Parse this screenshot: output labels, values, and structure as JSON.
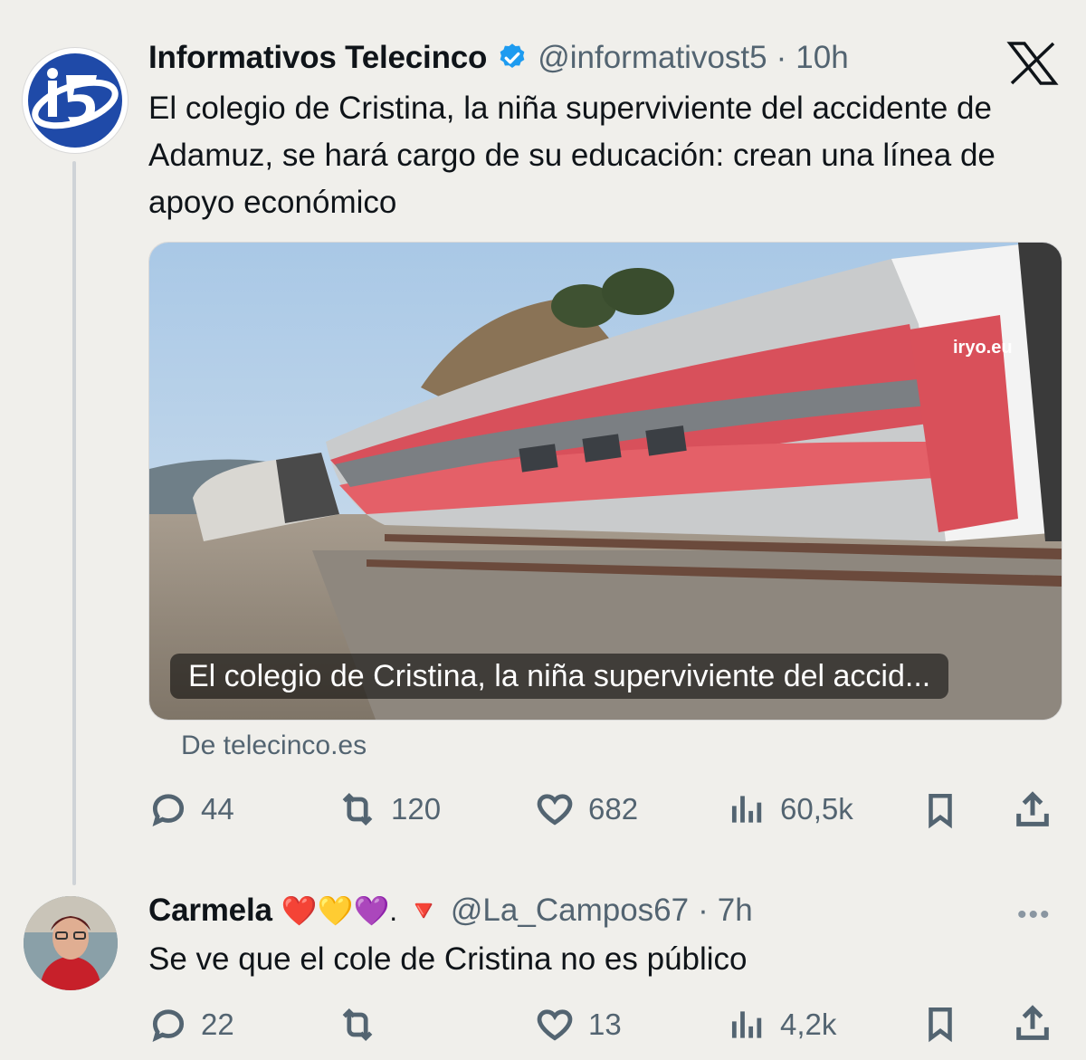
{
  "tweet": {
    "author_name": "Informativos Telecinco",
    "handle": "@informativost5",
    "separator": "·",
    "time": "10h",
    "text": "El colegio de Cristina, la niña superviviente del accidente de Adamuz, se hará cargo de su educación: crean una línea de apoyo económico",
    "card": {
      "caption": "El colegio de Cristina, la niña superviviente del accid...",
      "source": "De telecinco.es",
      "train_brand": "iryo.eu"
    },
    "metrics": {
      "replies": "44",
      "reposts": "120",
      "likes": "682",
      "views": "60,5k"
    }
  },
  "reply": {
    "author_name": "Carmela",
    "emojis": "❤️💛💜. 🔻",
    "handle": "@La_Campos67",
    "separator": "·",
    "time": "7h",
    "text": "Se ve que el cole de Cristina no es público",
    "more_icon": "•••",
    "metrics": {
      "replies": "22",
      "reposts": "",
      "likes": "13",
      "views": "4,2k"
    }
  },
  "platform_logo": "X",
  "colors": {
    "background": "#f0efeb",
    "verified": "#1d9bf0",
    "secondary_text": "#536471",
    "telecinco_blue": "#1f4aa8"
  }
}
